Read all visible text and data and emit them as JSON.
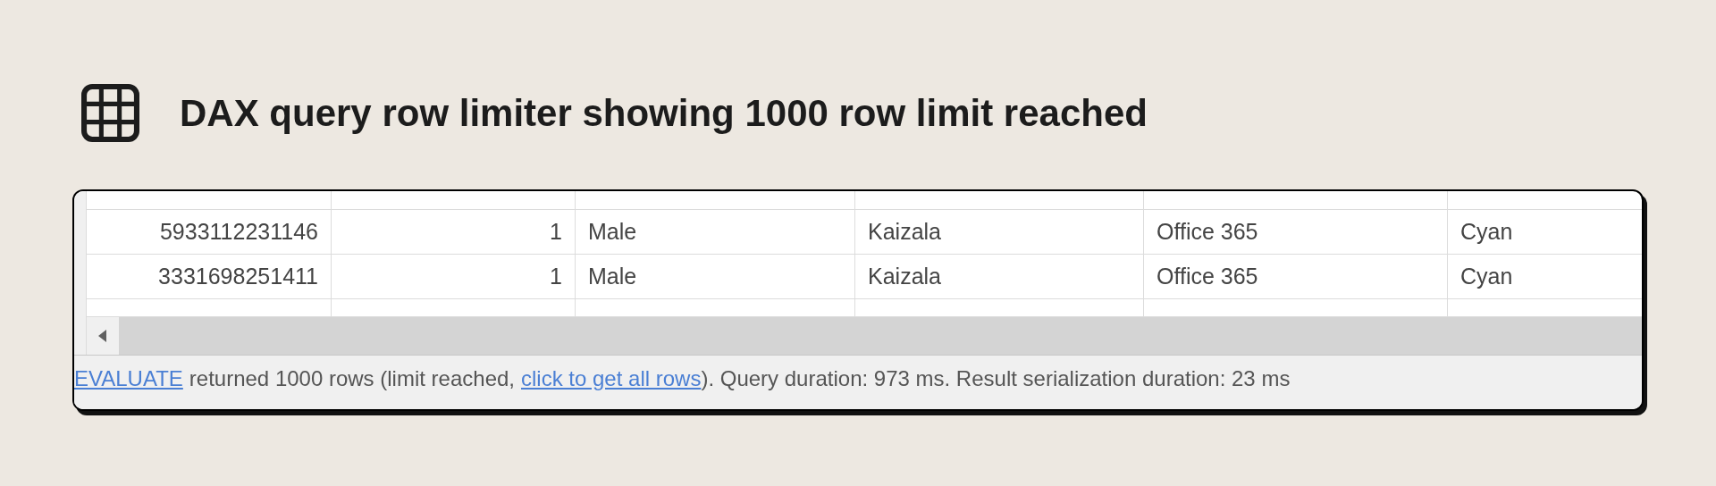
{
  "title": "DAX query row limiter showing 1000 row limit reached",
  "table": {
    "rows": [
      [
        "5933112231146",
        "1",
        "Male",
        "Kaizala",
        "Office 365",
        "Cyan"
      ],
      [
        "3331698251411",
        "1",
        "Male",
        "Kaizala",
        "Office 365",
        "Cyan"
      ]
    ]
  },
  "status_bar": {
    "evaluate_link": "EVALUATE",
    "text_1": "returned 1000 rows (limit reached,",
    "get_all_link": "click to get all rows",
    "text_2": "). Query duration: 973 ms. Result serialization duration: 23 ms"
  }
}
